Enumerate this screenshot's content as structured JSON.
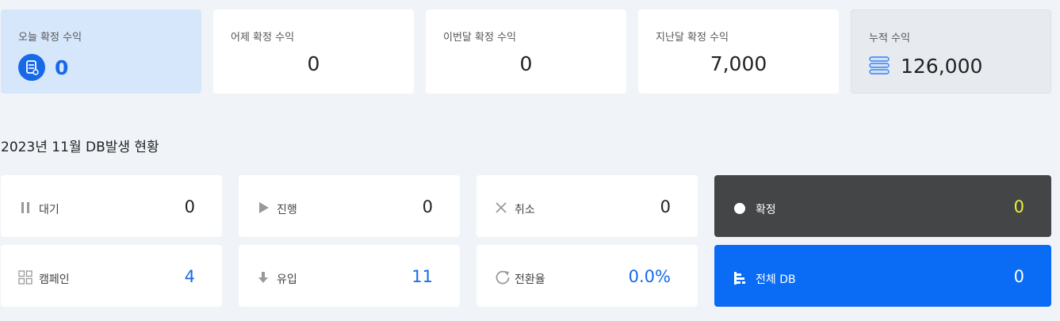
{
  "earnings": {
    "today": {
      "label": "오늘 확정 수익",
      "value": "0"
    },
    "yesterday": {
      "label": "어제 확정 수익",
      "value": "0"
    },
    "this_month": {
      "label": "이번달 확정 수익",
      "value": "0"
    },
    "last_month": {
      "label": "지난달 확정 수익",
      "value": "7,000"
    },
    "total": {
      "label": "누적 수익",
      "value": "126,000"
    }
  },
  "section": {
    "title": "2023년 11월 DB발생 현황"
  },
  "stats": {
    "waiting": {
      "label": "대기",
      "value": "0",
      "icon": "pause-icon"
    },
    "progress": {
      "label": "진행",
      "value": "0",
      "icon": "play-icon"
    },
    "cancel": {
      "label": "취소",
      "value": "0",
      "icon": "close-icon"
    },
    "confirmed": {
      "label": "확정",
      "value": "0",
      "icon": "dot-icon"
    },
    "campaign": {
      "label": "캠페인",
      "value": "4",
      "icon": "grid-icon"
    },
    "inflow": {
      "label": "유입",
      "value": "11",
      "icon": "arrow-down-icon"
    },
    "conversion": {
      "label": "전환율",
      "value": "0.0%",
      "icon": "refresh-icon"
    },
    "all_db": {
      "label": "전체 DB",
      "value": "0",
      "icon": "list-icon"
    }
  },
  "colors": {
    "accent": "#1769e8",
    "primary_card": "#0a6cf5",
    "dark_card": "#444547",
    "highlight_value": "#e9ef3a"
  }
}
